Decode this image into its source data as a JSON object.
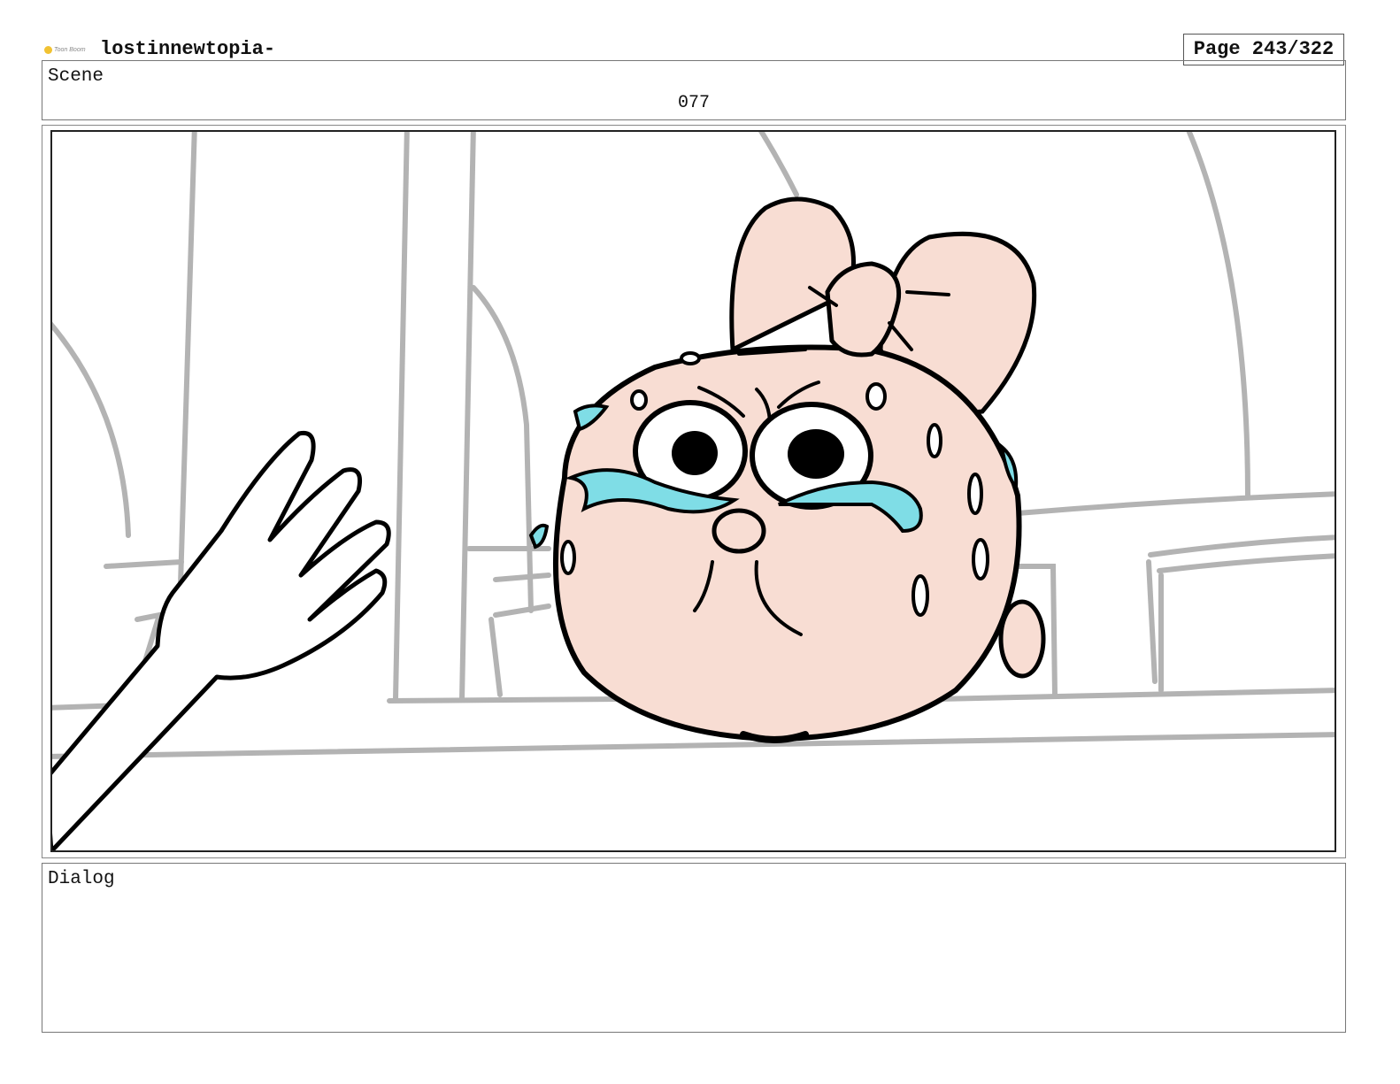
{
  "header": {
    "logo_text": "Toon Boom",
    "project_title": "lostinnewtopia-",
    "page_label": "Page 243/322"
  },
  "scene": {
    "label": "Scene",
    "number": "077"
  },
  "dialog": {
    "label": "Dialog"
  },
  "colors": {
    "skin": "#f8ddd3",
    "tears": "#7fdde6",
    "background_lines": "#b3b3b3",
    "ink": "#000000"
  }
}
